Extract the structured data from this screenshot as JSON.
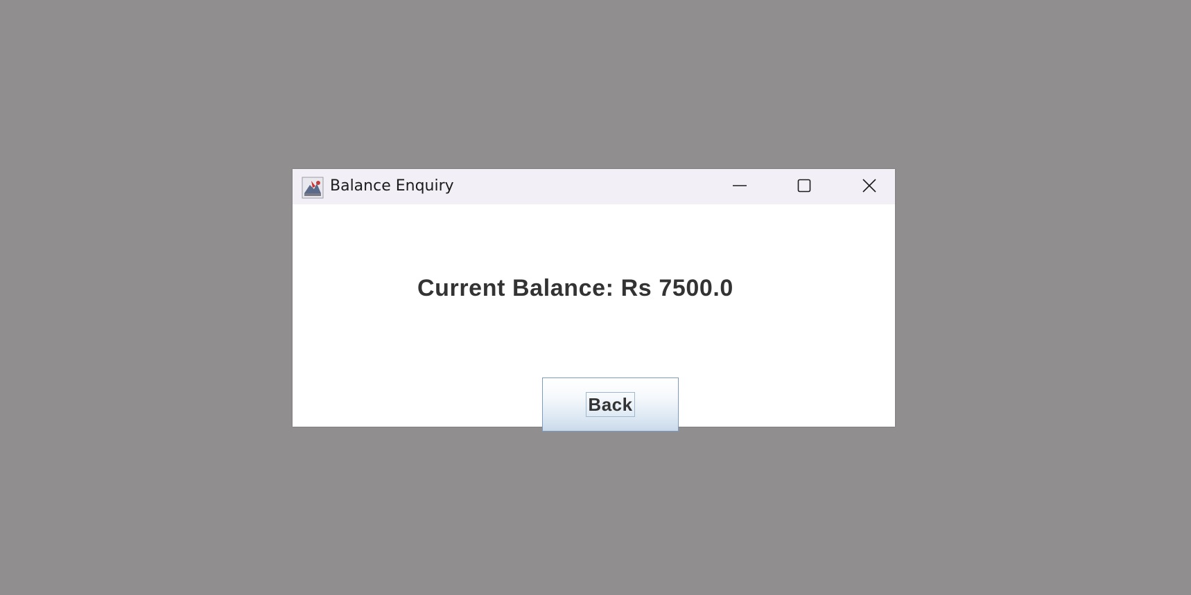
{
  "window": {
    "title": "Balance Enquiry",
    "app_icon": "java-app-icon",
    "controls": {
      "minimize_icon": "minimize-icon",
      "maximize_icon": "maximize-icon",
      "close_icon": "close-icon"
    }
  },
  "content": {
    "balance_text": "Current Balance: Rs 7500.0",
    "back_label": "Back"
  },
  "colors": {
    "desktop": "#918e8f",
    "titlebar": "#f2f0f6",
    "window_bg": "#ffffff",
    "text": "#333333",
    "button_border": "#7a9bbf"
  }
}
